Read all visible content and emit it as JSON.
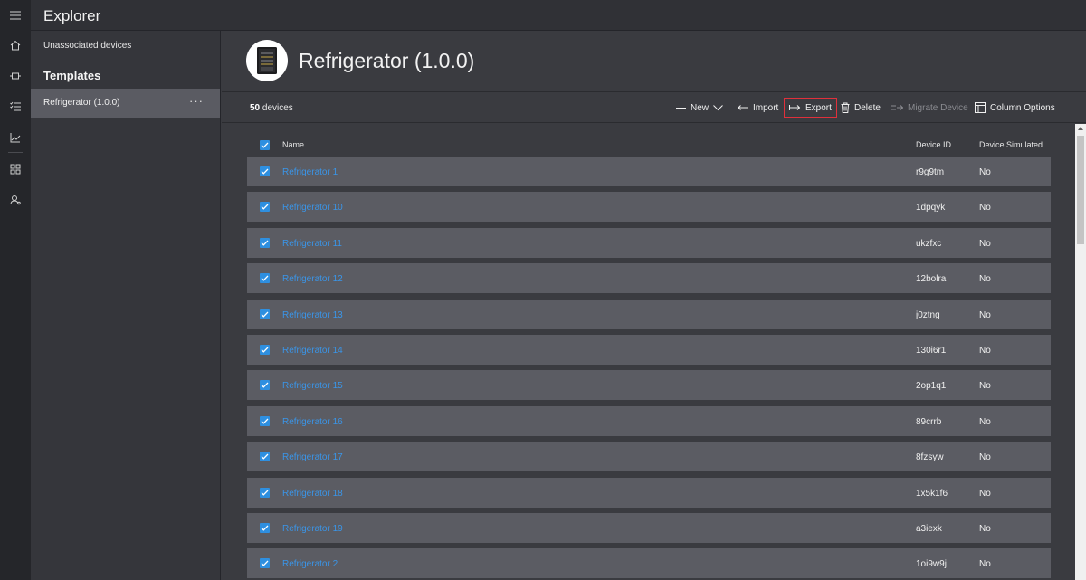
{
  "app": {
    "title": "Explorer"
  },
  "rail": {
    "icons": [
      "menu-icon",
      "home-icon",
      "device-icon",
      "rules-icon",
      "analytics-icon",
      "dashboard-icon",
      "admin-icon"
    ]
  },
  "sidebar": {
    "unassociated_label": "Unassociated devices",
    "templates_heading": "Templates",
    "selected_template": "Refrigerator (1.0.0)",
    "more_label": "···"
  },
  "header": {
    "title": "Refrigerator (1.0.0)"
  },
  "toolbar": {
    "count_number": "50",
    "count_suffix": " devices",
    "new_label": "New",
    "import_label": "Import",
    "export_label": "Export",
    "delete_label": "Delete",
    "migrate_label": "Migrate Device",
    "columns_label": "Column Options"
  },
  "table": {
    "columns": {
      "name": "Name",
      "device_id": "Device ID",
      "simulated": "Device Simulated"
    },
    "rows": [
      {
        "name": "Refrigerator 1",
        "id": "r9g9tm",
        "sim": "No"
      },
      {
        "name": "Refrigerator 10",
        "id": "1dpqyk",
        "sim": "No"
      },
      {
        "name": "Refrigerator 11",
        "id": "ukzfxc",
        "sim": "No"
      },
      {
        "name": "Refrigerator 12",
        "id": "12bolra",
        "sim": "No"
      },
      {
        "name": "Refrigerator 13",
        "id": "j0ztng",
        "sim": "No"
      },
      {
        "name": "Refrigerator 14",
        "id": "130i6r1",
        "sim": "No"
      },
      {
        "name": "Refrigerator 15",
        "id": "2op1q1",
        "sim": "No"
      },
      {
        "name": "Refrigerator 16",
        "id": "89crrb",
        "sim": "No"
      },
      {
        "name": "Refrigerator 17",
        "id": "8fzsyw",
        "sim": "No"
      },
      {
        "name": "Refrigerator 18",
        "id": "1x5k1f6",
        "sim": "No"
      },
      {
        "name": "Refrigerator 19",
        "id": "a3iexk",
        "sim": "No"
      },
      {
        "name": "Refrigerator 2",
        "id": "1oi9w9j",
        "sim": "No"
      }
    ]
  },
  "colors": {
    "accent": "#2e8fe0",
    "link": "#3a95e8",
    "highlight": "#e0303b",
    "row_bg": "#5b5c63"
  }
}
